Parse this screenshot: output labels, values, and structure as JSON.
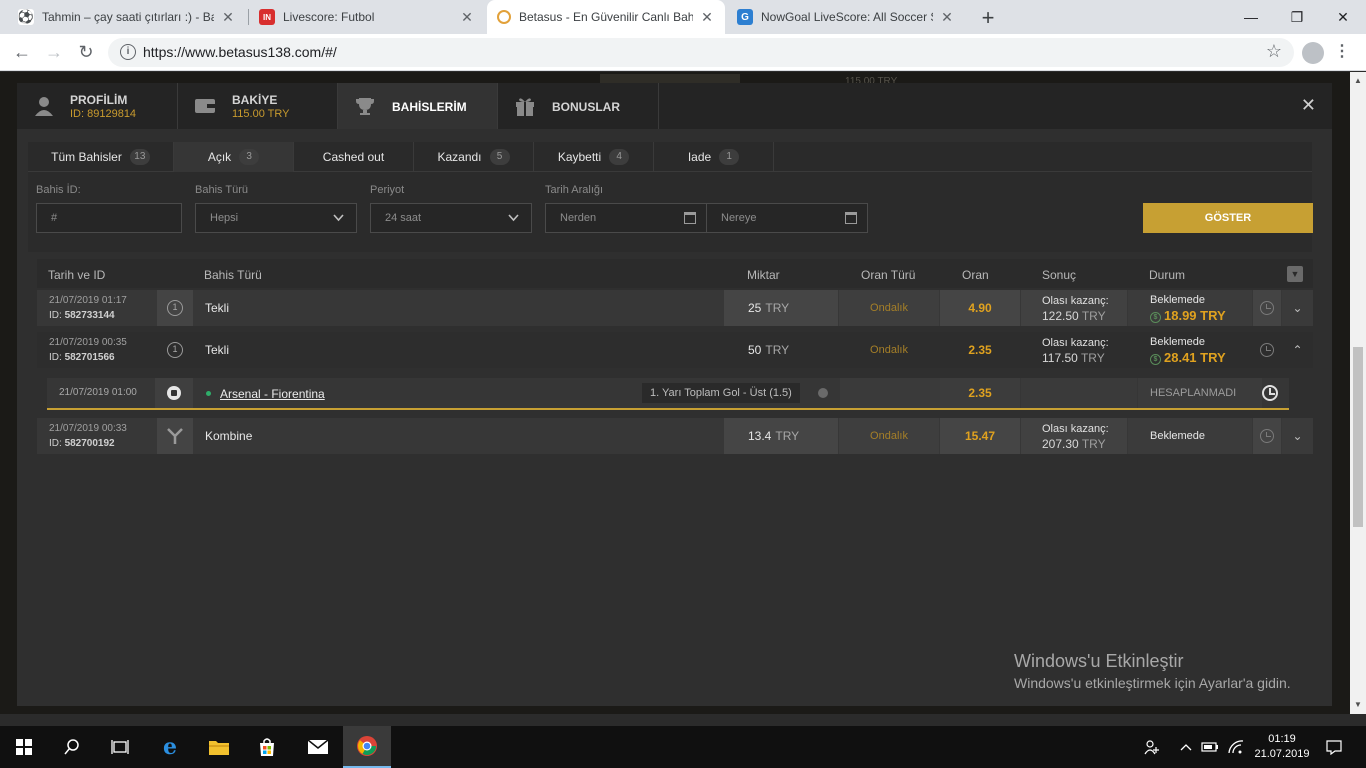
{
  "browser": {
    "tabs": [
      {
        "title": "Tahmin – çay saati çıtırları :) - Bah",
        "favicon": "soccer-ball-icon"
      },
      {
        "title": "Livescore: Futbol",
        "favicon": "livescore-icon",
        "badge": "IN"
      },
      {
        "title": "Betasus - En Güvenilir Canlı Bahis",
        "favicon": "betasus-icon"
      },
      {
        "title": "NowGoal LiveScore: All Soccer Sc",
        "favicon": "nowgoal-icon",
        "badge": "G"
      }
    ],
    "close_glyph": "✕",
    "new_tab_glyph": "+",
    "url": "https://www.betasus138.com/#/",
    "window_controls": {
      "minimize": "—",
      "maximize": "❐",
      "close": "✕"
    }
  },
  "background": {
    "ghost_text": "115.00 TRY"
  },
  "account": {
    "tabs": [
      {
        "label": "PROFİLİM",
        "sub": "ID: 89129814",
        "icon": "user-icon"
      },
      {
        "label": "BAKİYE",
        "sub": "115.00 TRY",
        "icon": "wallet-icon"
      },
      {
        "label": "BAHİSLERİM",
        "sub": "",
        "icon": "trophy-icon"
      },
      {
        "label": "BONUSLAR",
        "sub": "",
        "icon": "gift-icon"
      }
    ],
    "close_glyph": "✕"
  },
  "filter_tabs": [
    {
      "label": "Tüm Bahisler",
      "count": "13"
    },
    {
      "label": "Açık",
      "count": "3"
    },
    {
      "label": "Cashed out",
      "count": ""
    },
    {
      "label": "Kazandı",
      "count": "5"
    },
    {
      "label": "Kaybetti",
      "count": "4"
    },
    {
      "label": "Iade",
      "count": "1"
    }
  ],
  "filters": {
    "bet_id_label": "Bahis İD:",
    "bet_id_placeholder": "#",
    "bet_type_label": "Bahis Türü",
    "bet_type_value": "Hepsi",
    "period_label": "Periyot",
    "period_value": "24 saat",
    "date_range_label": "Tarih Aralığı",
    "date_from": "Nerden",
    "date_to": "Nereye",
    "show_button": "GÖSTER"
  },
  "table": {
    "headers": {
      "date_id": "Tarih ve ID",
      "bet_type": "Bahis Türü",
      "amount": "Miktar",
      "odds_type": "Oran Türü",
      "odds": "Oran",
      "result": "Sonuç",
      "status": "Durum"
    },
    "rows": [
      {
        "date": "21/07/2019 01:17",
        "id_prefix": "ID:",
        "id": "582733144",
        "type_icon": "1",
        "type": "Tekli",
        "amount": "25",
        "currency": "TRY",
        "odds_type": "Ondalık",
        "odds": "4.90",
        "payout_label": "Olası kazanç:",
        "payout": "122.50",
        "payout_currency": "TRY",
        "status": "Beklemede",
        "cashout": "18.99 TRY",
        "expand": "⌄"
      },
      {
        "date": "21/07/2019 00:35",
        "id_prefix": "ID:",
        "id": "582701566",
        "type_icon": "1",
        "type": "Tekli",
        "amount": "50",
        "currency": "TRY",
        "odds_type": "Ondalık",
        "odds": "2.35",
        "payout_label": "Olası kazanç:",
        "payout": "117.50",
        "payout_currency": "TRY",
        "status": "Beklemede",
        "cashout": "28.41 TRY",
        "expand": "⌃"
      },
      {
        "date": "21/07/2019 00:33",
        "id_prefix": "ID:",
        "id": "582700192",
        "type_icon": "Y",
        "type": "Kombine",
        "amount": "13.4",
        "currency": "TRY",
        "odds_type": "Ondalık",
        "odds": "15.47",
        "payout_label": "Olası kazanç:",
        "payout": "207.30",
        "payout_currency": "TRY",
        "status": "Beklemede",
        "cashout": "",
        "expand": "⌄"
      }
    ],
    "detail": {
      "date": "21/07/2019 01:00",
      "match": "Arsenal - Fiorentina",
      "market": "1. Yarı Toplam Gol - Üst (1.5)",
      "odds": "2.35",
      "status": "HESAPLANMADI"
    }
  },
  "watermark": {
    "title": "Windows'u Etkinleştir",
    "subtitle": "Windows'u etkinleştirmek için Ayarlar'a gidin."
  },
  "taskbar": {
    "time": "01:19",
    "date": "21.07.2019"
  },
  "colors": {
    "accent": "#c7a033",
    "odds": "#e0a21f",
    "panel": "#2f2f2f"
  }
}
